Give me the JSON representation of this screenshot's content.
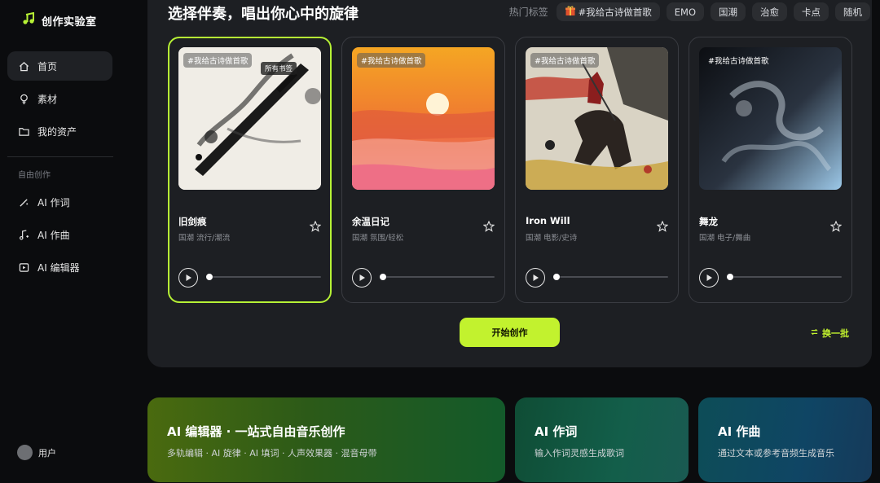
{
  "app": {
    "title": "创作实验室"
  },
  "sidebar": {
    "items": [
      {
        "label": "首页",
        "icon": "home-icon"
      },
      {
        "label": "素材",
        "icon": "lightbulb-icon"
      },
      {
        "label": "我的资产",
        "icon": "folder-icon"
      }
    ],
    "section_label": "自由创作",
    "create_items": [
      {
        "label": "AI 作词",
        "icon": "magic-pen-icon"
      },
      {
        "label": "AI 作曲",
        "icon": "music-add-icon"
      },
      {
        "label": "AI 编辑器",
        "icon": "editor-icon"
      }
    ],
    "user": "用户"
  },
  "main": {
    "title": "选择伴奏，唱出你心中的旋律",
    "tags_label": "热门标签",
    "tags": [
      "#我给古诗做首歌",
      "EMO",
      "国潮",
      "治愈",
      "卡点",
      "随机"
    ],
    "cards": [
      {
        "title": "旧剑痕",
        "meta": "国潮 流行/潮流",
        "cover_tag": "#我给古诗做首歌",
        "badge": "所有书签",
        "selected": true
      },
      {
        "title": "余温日记",
        "meta": "国潮 氛围/轻松",
        "cover_tag": "#我给古诗做首歌",
        "selected": false
      },
      {
        "title": "Iron Will",
        "meta": "国潮 电影/史诗",
        "cover_tag": "#我给古诗做首歌",
        "selected": false
      },
      {
        "title": "舞龙",
        "meta": "国潮 电子/舞曲",
        "cover_tag": "#我给古诗做首歌",
        "selected": false
      }
    ],
    "start_button": "开始创作",
    "refresh_label": "换一批"
  },
  "features": [
    {
      "title": "AI 编辑器 · 一站式自由音乐创作",
      "desc": "多轨编辑 · AI 旋律 · AI 填词 · 人声效果器 · 混音母带"
    },
    {
      "title": "AI 作词",
      "desc": "输入作词灵感生成歌词"
    },
    {
      "title": "AI 作曲",
      "desc": "通过文本或参考音频生成音乐"
    }
  ],
  "colors": {
    "accent": "#c2f22e",
    "panel": "#1d1f23",
    "background": "#0b0c0e"
  }
}
